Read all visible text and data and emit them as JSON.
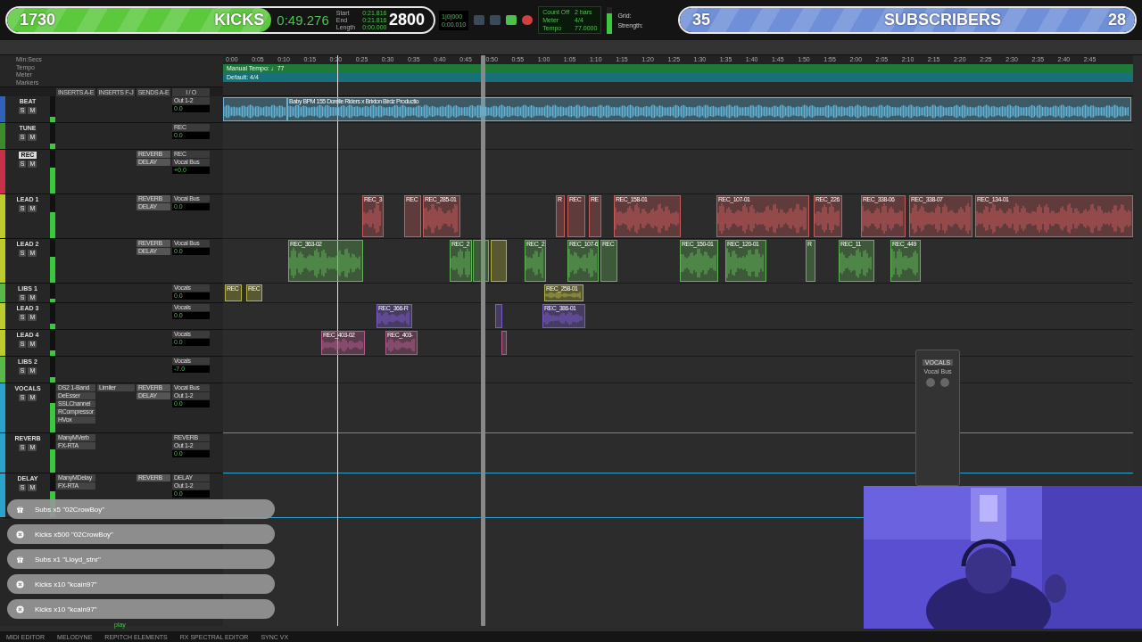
{
  "goal_bars": [
    {
      "kind": "kicks",
      "count": "1730",
      "label": "KICKS",
      "target": "2800",
      "level": 0.62,
      "color": "#5cc83c"
    },
    {
      "kind": "subscribers",
      "count": "35",
      "label": "SUBSCRIBERS",
      "target": "28",
      "level": 1,
      "color": "#6f8fd8"
    }
  ],
  "transport": {
    "main_counter": "0:49.276",
    "selection_labels": [
      "Start",
      "End",
      "Length"
    ],
    "selection_values": [
      "0:21.816",
      "0:21.816",
      "0:00.000"
    ],
    "sub_counter": [
      "1|0|000",
      "0:00.010"
    ],
    "count_off": "Count Off",
    "meter_label": "Meter",
    "tempo_label": "Tempo",
    "bars": "2 bars",
    "meter": "4/4",
    "tempo": "77.0000",
    "grid_label": "Grid:",
    "strength_label": "Strength:"
  },
  "rulers": [
    "Min:Secs",
    "Tempo",
    "Meter",
    "Markers"
  ],
  "tempo_ruler": "Manual Tempo: ♩77",
  "meter_ruler": "Default: 4/4",
  "timeline_ticks": [
    "0:00",
    "0:05",
    "0:10",
    "0:15",
    "0:20",
    "0:25",
    "0:30",
    "0:35",
    "0:40",
    "0:45",
    "0:50",
    "0:55",
    "1:00",
    "1:05",
    "1:10",
    "1:15",
    "1:20",
    "1:25",
    "1:30",
    "1:35",
    "1:40",
    "1:45",
    "1:50",
    "1:55",
    "2:00",
    "2:05",
    "2:10",
    "2:15",
    "2:20",
    "2:25",
    "2:30",
    "2:35",
    "2:40",
    "2:45"
  ],
  "columns": [
    "INSERTS A-E",
    "INSERTS F-J",
    "SENDS A-E",
    "I / O"
  ],
  "tracks": [
    {
      "name": "BEAT",
      "color": "#2f62b8",
      "buttons": [
        "S",
        "M"
      ],
      "io": [
        "Out 1-2"
      ],
      "volume": "0.0",
      "clips": [
        {
          "color": "#5fb4d8"
        },
        {
          "label": "Baby BPM 155 Dorelle Riders x Brixton Birdz Productio",
          "color": "#5fb4d8"
        }
      ]
    },
    {
      "name": "TUNE",
      "color": "#3f8a2a",
      "buttons": [
        "S",
        "M"
      ],
      "io": [
        "REC"
      ],
      "volume": "0.0"
    },
    {
      "name": "REC",
      "color": "#c8304a",
      "selected": true,
      "buttons": [
        "S",
        "M"
      ],
      "sends": [
        "REVERB",
        "DELAY"
      ],
      "io": [
        "REC",
        "Vocal Bus"
      ],
      "volume": "+0.0"
    },
    {
      "name": "LEAD 1",
      "color": "#bccb2e",
      "selected": false,
      "buttons": [
        "S",
        "M"
      ],
      "sends": [
        "REVERB",
        "DELAY"
      ],
      "io": [
        "Vocal Bus"
      ],
      "volume": "0.0",
      "clips": [
        {
          "label": "REC_3",
          "color": "#c85a5a"
        },
        {
          "label": "REC",
          "color": "#c85a5a"
        },
        {
          "label": "REC_285-01",
          "color": "#c85a5a"
        },
        {
          "label": "R",
          "color": "#c85a5a"
        },
        {
          "label": "REC",
          "color": "#c85a5a"
        },
        {
          "label": "RE",
          "color": "#c85a5a"
        },
        {
          "label": "REC_158-01",
          "color": "#c85a5a"
        },
        {
          "label": "REC_107-01",
          "color": "#c85a5a"
        },
        {
          "label": "REC_226",
          "color": "#c85a5a"
        },
        {
          "label": "REC_338-06",
          "color": "#c85a5a"
        },
        {
          "label": "REC_338-07",
          "color": "#c85a5a"
        },
        {
          "label": "REC_134-01",
          "color": "#c85a5a"
        }
      ]
    },
    {
      "name": "LEAD 2",
      "color": "#bccb2e",
      "selected": false,
      "buttons": [
        "S",
        "M"
      ],
      "sends": [
        "REVERB",
        "DELAY"
      ],
      "io": [
        "Vocal Bus"
      ],
      "volume": "0.0",
      "clips": [
        {
          "label": "REC_363-02",
          "color": "#5fb455"
        },
        {
          "label": "REC_2",
          "color": "#5fb455"
        },
        {
          "color": "#5fb455"
        },
        {
          "color": "#b4b43c"
        },
        {
          "label": "REC_2",
          "color": "#5fb455"
        },
        {
          "label": "REC_107-6",
          "color": "#5fb455"
        },
        {
          "label": "REC",
          "color": "#5fb455"
        },
        {
          "label": "REC_150-01",
          "color": "#5fb455"
        },
        {
          "label": "REC_120-01",
          "color": "#5fb455"
        },
        {
          "label": "R",
          "color": "#5fb455"
        },
        {
          "label": "REC_11",
          "color": "#5fb455"
        },
        {
          "label": "REC_449",
          "color": "#5fb455"
        }
      ]
    },
    {
      "name": "LIBS 1",
      "color": "#5ab84a",
      "buttons": [
        "S",
        "M"
      ],
      "io": [
        "Vocals"
      ],
      "volume": "0.0",
      "clips": [
        {
          "label": "REC",
          "color": "#b4b43c"
        },
        {
          "label": "REC",
          "color": "#b4b43c"
        },
        {
          "label": "REC_258-01",
          "color": "#b4b43c"
        }
      ]
    },
    {
      "name": "LEAD 3",
      "color": "#bccb2e",
      "buttons": [
        "S",
        "M"
      ],
      "io": [
        "Vocals"
      ],
      "volume": "0.0",
      "clips": [
        {
          "label": "REC_366-R",
          "color": "#7a5ac8"
        },
        {
          "color": "#7a5ac8"
        },
        {
          "label": "REC_386-01",
          "color": "#7a5ac8"
        }
      ]
    },
    {
      "name": "LEAD 4",
      "color": "#bccb2e",
      "buttons": [
        "S",
        "M"
      ],
      "io": [
        "Vocals"
      ],
      "volume": "0.0",
      "clips": [
        {
          "label": "REC_403-02",
          "color": "#b45a8c"
        },
        {
          "label": "REC_403-",
          "color": "#b45a8c"
        },
        {
          "color": "#b45a8c"
        }
      ]
    },
    {
      "name": "LIBS 2",
      "color": "#5ab84a",
      "buttons": [
        "S",
        "M"
      ],
      "io": [
        "Vocals"
      ],
      "volume": "-7.0"
    },
    {
      "name": "VOCALS",
      "color": "#2aa2cc",
      "selected": false,
      "buttons": [
        "S",
        "M"
      ],
      "inserts": [
        "DS2 1-Band",
        "DeEsser",
        "SSLChannel",
        "RCompressor",
        "HVox",
        "Limiter"
      ],
      "sends": [
        "REVERB",
        "DELAY"
      ],
      "io": [
        "Vocal Bus",
        "Out 1-2"
      ],
      "volume": "0.0"
    },
    {
      "name": "REVERB",
      "color": "#2aa2cc",
      "selected": false,
      "buttons": [
        "S",
        "M"
      ],
      "inserts": [
        "ManyMVerb",
        "FX-RTA"
      ],
      "io": [
        "REVERB",
        "Out 1-2"
      ],
      "volume": "0.0"
    },
    {
      "name": "DELAY",
      "color": "#2aa2cc",
      "selected": false,
      "buttons": [
        "S",
        "M"
      ],
      "inserts": [
        "ManyMDelay",
        "FX-RTA"
      ],
      "sends": [
        "REVERB"
      ],
      "io": [
        "DELAY",
        "Out 1-2"
      ],
      "volume": "0.0"
    }
  ],
  "mini_mixer": {
    "title": "VOCALS",
    "output": "Vocal Bus"
  },
  "alerts": [
    {
      "kind": "gift",
      "text": "Subs x5 \"02CrowBoy\""
    },
    {
      "kind": "kick",
      "text": "Kicks x500 \"02CrowBoy\""
    },
    {
      "kind": "gift",
      "text": "Subs x1 \"Lloyd_stnr\""
    },
    {
      "kind": "kick",
      "text": "Kicks x10 \"kcain97\""
    },
    {
      "kind": "kick",
      "text": "Kicks x10 \"kcain97\""
    }
  ],
  "play_label": "play",
  "bottom_tabs": [
    "MIDI EDITOR",
    "MELODYNE",
    "REPITCH ELEMENTS",
    "RX SPECTRAL EDITOR",
    "SYNC VX"
  ],
  "webcam": {
    "kind": "picture"
  }
}
